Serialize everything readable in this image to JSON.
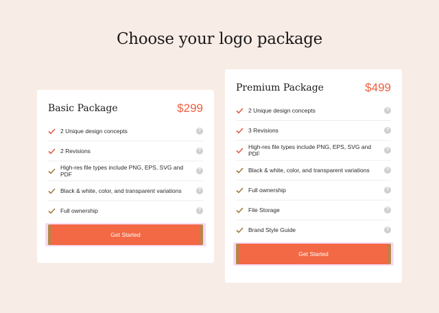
{
  "page": {
    "title": "Choose your logo package"
  },
  "colors": {
    "accent": "#f36845",
    "price": "#ec5f3f",
    "check": "#e15a42",
    "check_alt": "#9c7a3c",
    "background": "#f8ece6"
  },
  "icons": {
    "check": "checkmark-icon",
    "help": "question-mark-icon"
  },
  "plans": [
    {
      "name": "Basic Package",
      "price": "$299",
      "features": [
        "2 Unique design concepts",
        "2 Revisions",
        "High-res file types include PNG, EPS, SVG and PDF",
        "Black & white, color, and transparent variations",
        "Full ownership"
      ],
      "cta": "Get Started"
    },
    {
      "name": "Premium Package",
      "price": "$499",
      "features": [
        "2 Unique design concepts",
        "3 Revisions",
        "High-res file types include PNG, EPS, SVG and PDF",
        "Black & white, color, and transparent variations",
        "Full ownership",
        "File Storage",
        "Brand Style Guide"
      ],
      "cta": "Get Started"
    }
  ],
  "help_glyph": "?"
}
